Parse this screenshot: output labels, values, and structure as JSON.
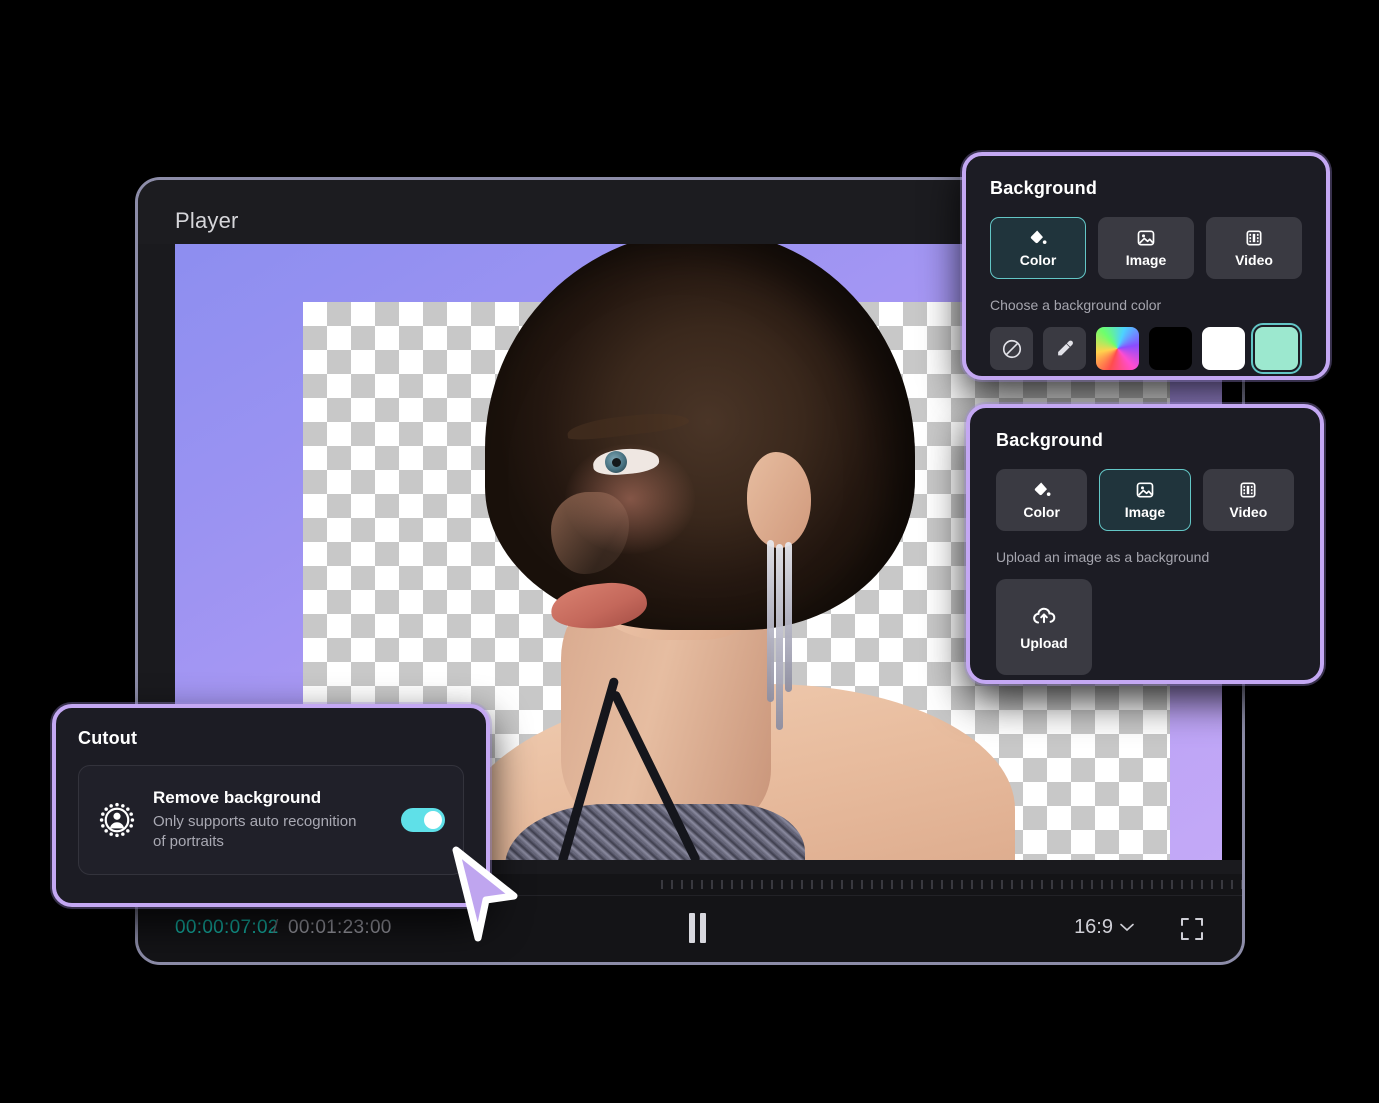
{
  "player": {
    "title": "Player",
    "time_current": "00:00:07:02",
    "time_separator": "/",
    "time_total": "00:01:23:00",
    "pause_icon": "pause-icon",
    "aspect_ratio": "16:9",
    "chevron_icon": "chevron-down-icon",
    "fullscreen_icon": "fullscreen-icon"
  },
  "background_color_panel": {
    "title": "Background",
    "tabs": [
      {
        "label": "Color",
        "icon": "paint-bucket-icon",
        "active": true
      },
      {
        "label": "Image",
        "icon": "image-icon",
        "active": false
      },
      {
        "label": "Video",
        "icon": "film-icon",
        "active": false
      }
    ],
    "helper_text": "Choose a background color",
    "swatches": [
      {
        "name": "no-color",
        "icon": "no-color-icon",
        "color": "#3a3a42",
        "selected": false
      },
      {
        "name": "eyedropper",
        "icon": "eyedropper-icon",
        "color": "#3a3a42",
        "selected": false
      },
      {
        "name": "color-picker",
        "icon": "rainbow-gradient",
        "color": "rainbow",
        "selected": false
      },
      {
        "name": "black",
        "icon": "",
        "color": "#000000",
        "selected": false
      },
      {
        "name": "white",
        "icon": "",
        "color": "#ffffff",
        "selected": false
      },
      {
        "name": "mint",
        "icon": "",
        "color": "#9ce8cf",
        "selected": true
      }
    ]
  },
  "background_image_panel": {
    "title": "Background",
    "tabs": [
      {
        "label": "Color",
        "icon": "paint-bucket-icon",
        "active": false
      },
      {
        "label": "Image",
        "icon": "image-icon",
        "active": true
      },
      {
        "label": "Video",
        "icon": "film-icon",
        "active": false
      }
    ],
    "helper_text": "Upload an image as a background",
    "upload_label": "Upload",
    "upload_icon": "cloud-upload-icon"
  },
  "cutout_panel": {
    "title": "Cutout",
    "icon": "portrait-recognition-icon",
    "option_title": "Remove background",
    "option_subtitle": "Only supports auto recognition of portraits",
    "toggle_on": true
  },
  "colors": {
    "panel_border": "#c4a8f3",
    "accent_teal": "#63c6c6",
    "toggle_on": "#5fe0e8",
    "timecode_current": "#14b5a8",
    "cursor": "#bfa5ef"
  }
}
